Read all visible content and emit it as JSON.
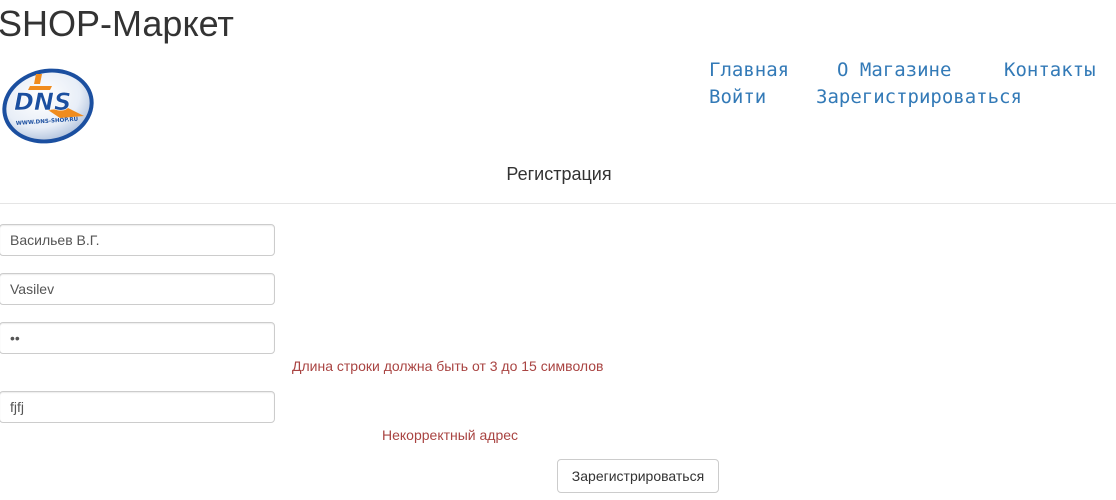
{
  "header": {
    "site_title": "SHOP-Маркет",
    "logo_text": "DNS",
    "logo_url_text": "WWW.DNS-SHOP.RU"
  },
  "nav": {
    "items": [
      {
        "label": "Главная"
      },
      {
        "label": "О Магазине"
      },
      {
        "label": "Контакты"
      },
      {
        "label": "Войти"
      },
      {
        "label": "Зарегистрироваться"
      }
    ]
  },
  "form": {
    "title": "Регистрация",
    "fields": {
      "name": {
        "value": "Васильев В.Г."
      },
      "login": {
        "value": "Vasilev"
      },
      "password": {
        "value": "12"
      },
      "email": {
        "value": "fjfj"
      }
    },
    "errors": {
      "password": "Длина строки должна быть от 3 до 15 символов",
      "email": "Некорректный адрес"
    },
    "submit_label": "Зарегистрироваться"
  },
  "colors": {
    "link": "#337ab7",
    "error": "#a94442",
    "text": "#333333",
    "logo_orange": "#f08c1e",
    "logo_blue": "#1b4fa0"
  }
}
